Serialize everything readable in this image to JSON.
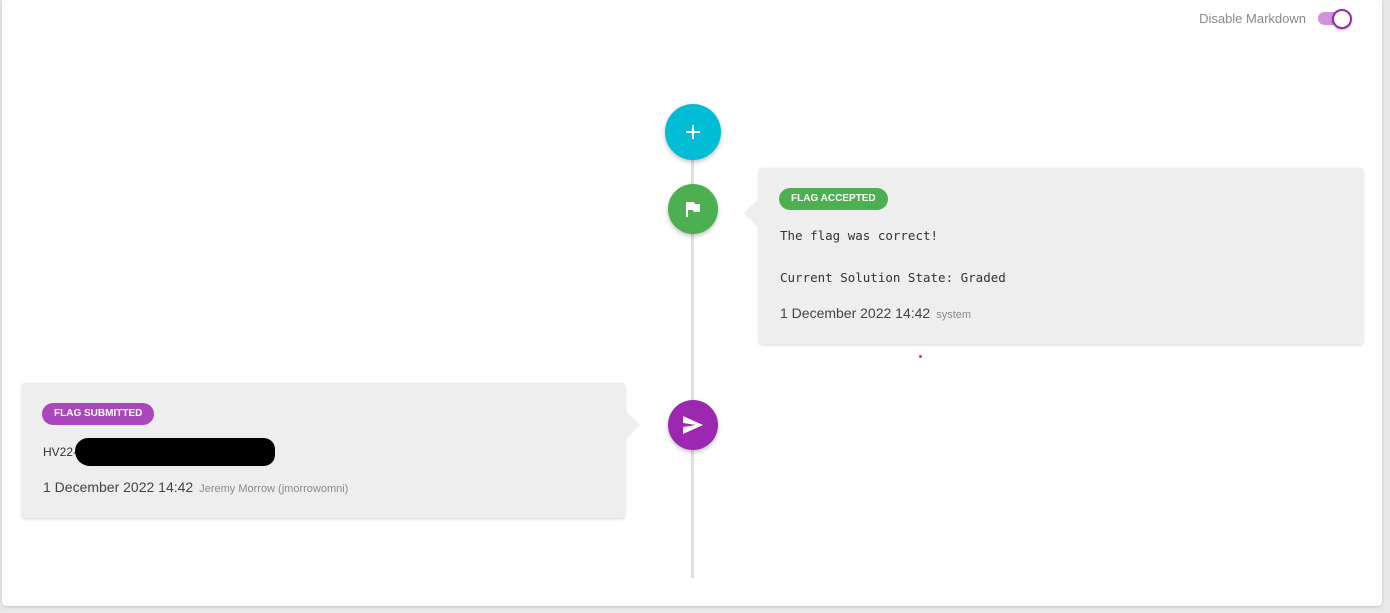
{
  "settings": {
    "markdown_toggle_label": "Disable Markdown",
    "markdown_disabled": true
  },
  "timeline": {
    "add_button_icon": "plus-icon",
    "entries": [
      {
        "badge": "FLAG ACCEPTED",
        "badge_color": "#4caf50",
        "node_icon": "flag-icon",
        "message_line1": "The flag was correct!",
        "message_line2": "Current Solution State: Graded",
        "date": "1 December 2022 14:42",
        "author": "system"
      },
      {
        "badge": "FLAG SUBMITTED",
        "badge_color": "#ab47bc",
        "node_icon": "send-icon",
        "flag_value": "HV22-",
        "date": "1 December 2022 14:42",
        "author": "Jeremy Morrow (jmorrowomni)"
      }
    ]
  },
  "colors": {
    "add_node": "#00bcd4",
    "accepted_node": "#4caf50",
    "submitted_node": "#9c27b0",
    "toggle_accent": "#9c27b0"
  }
}
